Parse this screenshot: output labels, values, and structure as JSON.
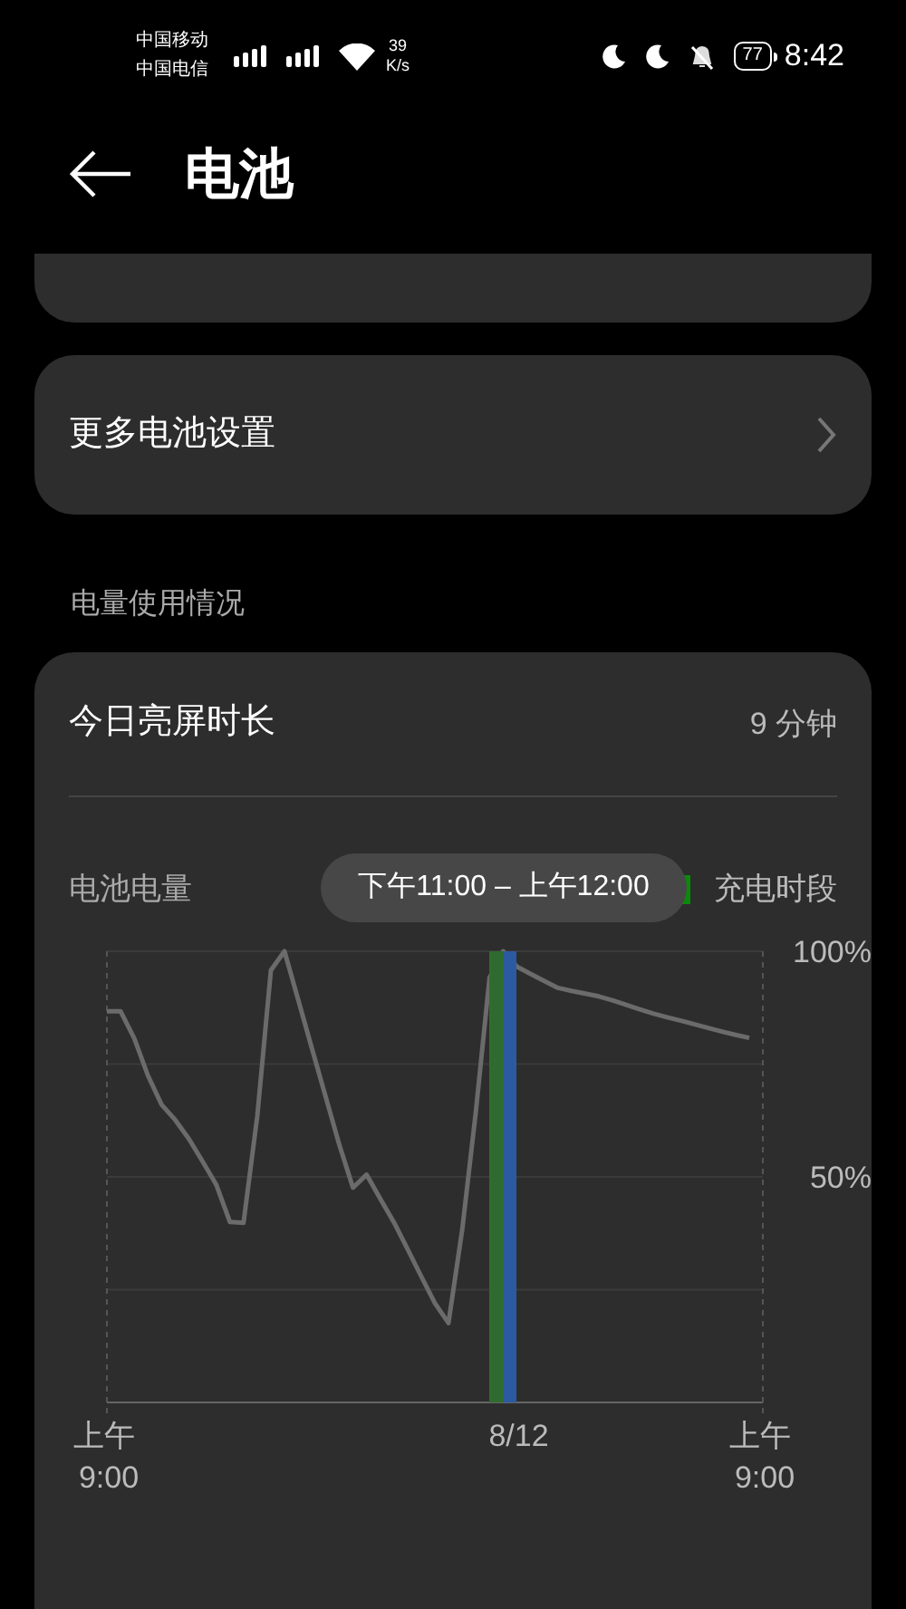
{
  "status_bar": {
    "carriers": [
      "中国移动",
      "中国电信"
    ],
    "speed_value": "39",
    "speed_unit": "K/s",
    "battery": "77",
    "time": "8:42"
  },
  "header": {
    "title": "电池"
  },
  "settings": [
    {
      "label": "更多电池设置"
    }
  ],
  "section_label": "电量使用情况",
  "usage_card": {
    "screen_time_label": "今日亮屏时长",
    "screen_time_value": "9 分钟",
    "legend": {
      "label": "充电时段",
      "color": "#0a8a0a"
    },
    "tooltip": "下午11:00 – 上午12:00",
    "chart_data": {
      "type": "line",
      "categories": [
        "上午 9:00",
        null,
        null,
        null,
        null,
        null,
        null,
        null,
        null,
        null,
        null,
        null,
        null,
        null,
        null,
        null,
        null,
        null,
        null,
        null,
        null,
        null,
        null,
        null,
        null,
        null,
        null,
        null,
        null,
        null,
        "8/12",
        null,
        null,
        null,
        null,
        null,
        null,
        null,
        null,
        null,
        null,
        null,
        null,
        null,
        null,
        null,
        null,
        null,
        "上午 9:00"
      ],
      "series": [
        {
          "name": "电池电量",
          "color": "#6b6b6b",
          "values": [
            86.7,
            86.7,
            80.7,
            72.5,
            66.0,
            62.6,
            58.4,
            53.4,
            48.3,
            40.0,
            39.8,
            63.5,
            95.8,
            100,
            89.2,
            78.5,
            67.8,
            57.2,
            47.6,
            50.5,
            45.2,
            39.9,
            34.0,
            27.9,
            22.0,
            17.6,
            38.3,
            64.4,
            94.2,
            100,
            96.6,
            95.0,
            93.4,
            91.9,
            91.2,
            90.6,
            90.0,
            89.1,
            88.1,
            87.1,
            86.2,
            85.4,
            84.6,
            83.8,
            83.0,
            82.2,
            81.5,
            80.8,
            null
          ]
        }
      ],
      "ylim": [
        0,
        100
      ],
      "yticks": [
        {
          "value": 100,
          "label": "100%"
        },
        {
          "value": 50,
          "label": "50%"
        }
      ]
    },
    "charging_bands": [
      {
        "color": "#2f6b30"
      },
      {
        "color": "#2c5aa0"
      }
    ]
  }
}
